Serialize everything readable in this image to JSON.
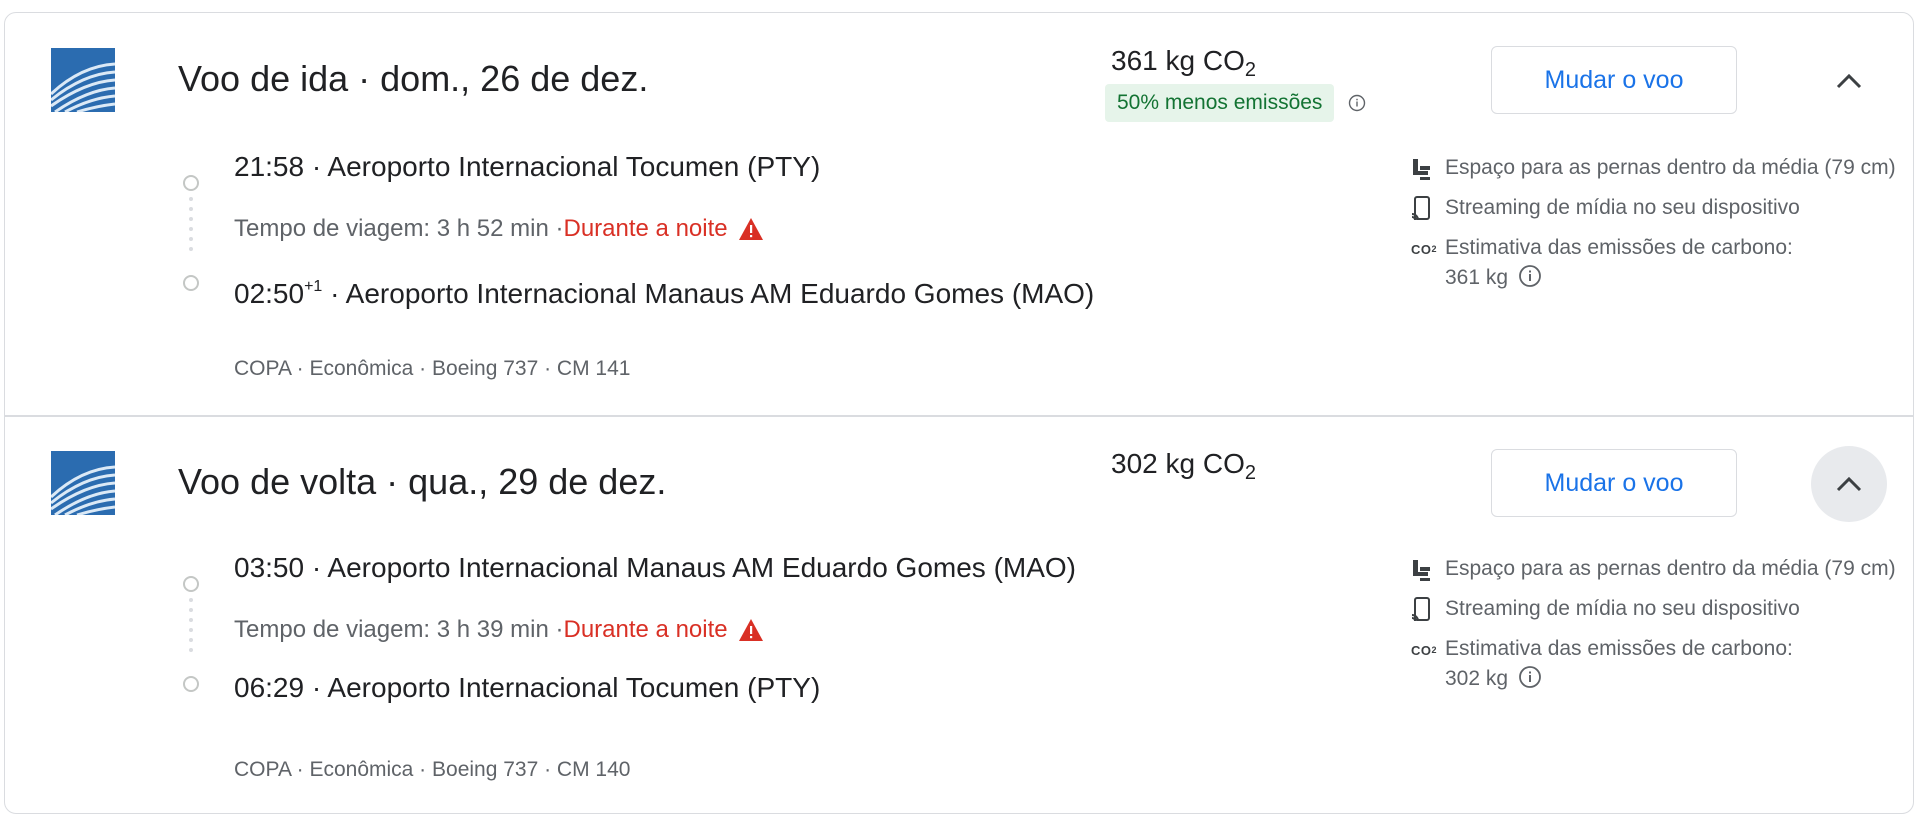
{
  "flights": [
    {
      "title": "Voo de ida · dom., 26 de dez.",
      "co2_value": "361 kg CO",
      "co2_sub": "2",
      "emissions_badge": "50% menos emissões",
      "change_button": "Mudar o voo",
      "departure_time": "21:58",
      "departure_airport": "Aeroporto Internacional Tocumen (PTY)",
      "travel_time": "Tempo de viagem: 3 h 52 min · ",
      "overnight": "Durante a noite",
      "arrival_time": "02:50",
      "arrival_day_offset": "+1",
      "arrival_airport": "Aeroporto Internacional Manaus AM Eduardo Gomes (MAO)",
      "details": "COPA · Econômica · Boeing 737 · CM 141",
      "amenities": {
        "legroom": "Espaço para as pernas dentro da média (79 cm)",
        "streaming": "Streaming de mídia no seu dispositivo",
        "emissions_label": "Estimativa das emissões de carbono:",
        "emissions_value": "361 kg"
      }
    },
    {
      "title": "Voo de volta · qua., 29 de dez.",
      "co2_value": "302 kg CO",
      "co2_sub": "2",
      "change_button": "Mudar o voo",
      "departure_time": "03:50",
      "departure_airport": "Aeroporto Internacional Manaus AM Eduardo Gomes (MAO)",
      "travel_time": "Tempo de viagem: 3 h 39 min · ",
      "overnight": "Durante a noite",
      "arrival_time": "06:29",
      "arrival_airport": "Aeroporto Internacional Tocumen (PTY)",
      "details": "COPA · Econômica · Boeing 737 · CM 140",
      "amenities": {
        "legroom": "Espaço para as pernas dentro da média (79 cm)",
        "streaming": "Streaming de mídia no seu dispositivo",
        "emissions_label": "Estimativa das emissões de carbono:",
        "emissions_value": "302 kg"
      }
    }
  ],
  "co2_icon_label": "CO",
  "co2_icon_sub": "2",
  "icons": {
    "airline_logo": "copa-airlines-logo",
    "collapse": "chevron-up-icon",
    "info": "info-icon",
    "warning": "warning-icon",
    "legroom": "seat-icon",
    "streaming": "phone-stream-icon",
    "co2": "co2-icon"
  },
  "colors": {
    "accent": "#1a73e8",
    "warning": "#d93025",
    "eco_text": "#137333",
    "eco_bg": "#e6f4ea"
  }
}
